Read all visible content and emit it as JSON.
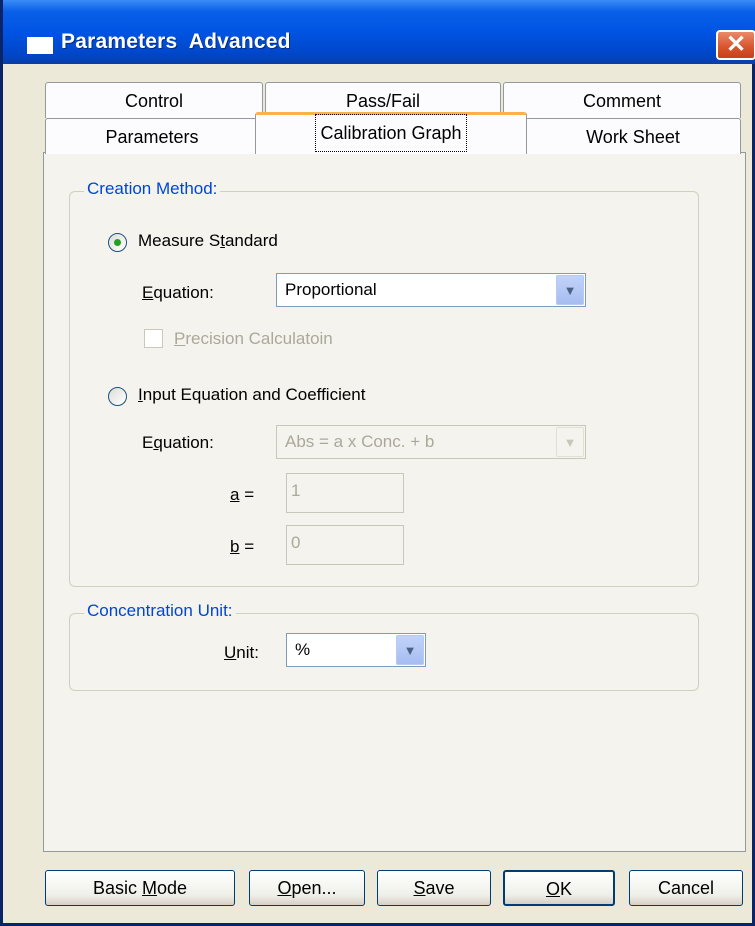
{
  "window": {
    "title": "Parameters  Advanced",
    "close_glyph": "✕"
  },
  "tabs": {
    "row1": [
      {
        "label": "Control"
      },
      {
        "label": "Pass/Fail"
      },
      {
        "label": "Comment"
      }
    ],
    "row2": [
      {
        "label": "Parameters"
      },
      {
        "label": "Calibration Graph",
        "active": true
      },
      {
        "label": "Work Sheet"
      }
    ]
  },
  "creation_method": {
    "group_label": "Creation Method:",
    "measure_standard": {
      "label_pre": "Measure S",
      "label_mnemonic": "t",
      "label_post": "andard",
      "selected": true
    },
    "equation_label_mnemonic": "E",
    "equation_label_post": "quation:",
    "equation_value": "Proportional",
    "precision": {
      "label_mnemonic": "P",
      "label_post": "recision Calculatoin",
      "checked": false,
      "enabled": false
    },
    "input_equation": {
      "label_mnemonic": "I",
      "label_post": "nput Equation and Coefficient",
      "selected": false
    },
    "equation2_label_pre": "E",
    "equation2_label_mnemonic": "q",
    "equation2_label_post": "uation:",
    "equation2_value": "Abs = a x Conc. + b",
    "a_label_mnemonic": "a",
    "a_label_post": " =",
    "a_value": "1",
    "b_label_mnemonic": "b",
    "b_label_post": " =",
    "b_value": "0"
  },
  "concentration_unit": {
    "group_label": "Concentration Unit:",
    "unit_label_mnemonic": "U",
    "unit_label_post": "nit:",
    "unit_value": "%"
  },
  "buttons": {
    "basic_mode": {
      "pre": "Basic ",
      "mnemonic": "M",
      "post": "ode"
    },
    "open": {
      "mnemonic": "O",
      "post": "pen..."
    },
    "save": {
      "mnemonic": "S",
      "post": "ave"
    },
    "ok": {
      "mnemonic": "O",
      "post": "K"
    },
    "cancel": {
      "label": "Cancel"
    }
  },
  "colors": {
    "titlebar": "#0054e3",
    "group_label": "#0046d5",
    "active_tab_accent": "#f9b348",
    "radio_dot": "#21a121"
  }
}
